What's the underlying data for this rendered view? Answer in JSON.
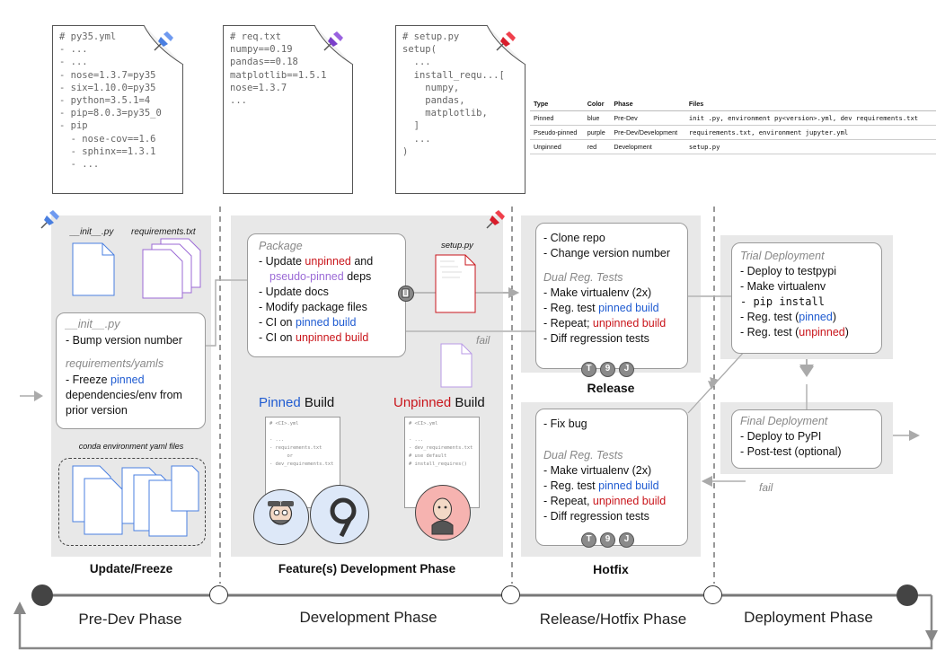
{
  "top_docs": {
    "py35": [
      "# py35.yml",
      "- ...",
      "- ...",
      "- nose=1.3.7=py35",
      "- six=1.10.0=py35",
      "- python=3.5.1=4",
      "- pip=8.0.3=py35_0",
      "- pip",
      "  - nose-cov==1.6",
      "  - sphinx==1.3.1",
      "  - ..."
    ],
    "req": [
      "# req.txt",
      "numpy==0.19",
      "pandas==0.18",
      "matplotlib==1.5.1",
      "nose=1.3.7",
      "..."
    ],
    "setup": [
      "# setup.py",
      "setup(",
      "  ...",
      "  install_requ...[",
      "    numpy,",
      "    pandas,",
      "    matplotlib,",
      "  ]",
      "  ...",
      ")"
    ]
  },
  "legend": {
    "headers": [
      "Type",
      "Color",
      "Phase",
      "Files"
    ],
    "rows": [
      [
        "Pinned",
        "blue",
        "Pre-Dev",
        "init  .py, environment  py<version>.yml, dev  requirements.txt"
      ],
      [
        "Pseudo-pinned",
        "purple",
        "Pre-Dev/Development",
        "requirements.txt, environment  jupyter.yml"
      ],
      [
        "Unpinned",
        "red",
        "Development",
        "setup.py"
      ]
    ]
  },
  "freeze": {
    "file1": "__init__.py",
    "file2": "requirements.txt",
    "card_title1": "__init__.py",
    "card_line1": "- Bump version number",
    "card_title2": "requirements/yamls",
    "card_line2a": "- Freeze ",
    "card_line2b": "pinned",
    "card_line3": "dependencies/env from",
    "card_line4": "prior version",
    "conda_label": "conda environment yaml files",
    "title": "Update/Freeze"
  },
  "dev": {
    "heading": "Package",
    "l1a": "- Update ",
    "l1b": "unpinned",
    "l1c": " and",
    "l2a": "pseudo-pinned",
    "l2b": " deps",
    "l3": "- Update docs",
    "l4": "- Modify package files",
    "l5a": "- CI on ",
    "l5b": "pinned build",
    "l6a": "- CI on ",
    "l6b": "unpinned build",
    "setup_label": "setup.py",
    "pinned_build_a": "Pinned",
    "pinned_build_b": " Build",
    "unpinned_build_a": "Unpinned",
    "unpinned_build_b": " Build",
    "ci_doc1": [
      "# <CI>.yml",
      "",
      "- ...",
      "- requirements.txt",
      "      or",
      "- dev_requirements.txt"
    ],
    "ci_doc2": [
      "# <CI>.yml",
      "",
      "- ...",
      "- dev_requirements.txt",
      "# use default",
      "# install_requires()"
    ],
    "title": "Feature(s) Development Phase"
  },
  "release": {
    "l1": "- Clone repo",
    "l2": "- Change version number",
    "h2": "Dual Reg. Tests",
    "l3": "- Make virtualenv (2x)",
    "l4a": "- Reg. test ",
    "l4b": "pinned build",
    "l5a": "- Repeat; ",
    "l5b": "unpinned build",
    "l6": "- Diff regression tests",
    "title": "Release",
    "fail": "fail"
  },
  "hotfix": {
    "l1": "- Fix bug",
    "h2": "Dual Reg. Tests",
    "l3": "- Make virtualenv (2x)",
    "l4a": "- Reg. test ",
    "l4b": "pinned build",
    "l5a": "- Repeat, ",
    "l5b": "unpinned build",
    "l6": "- Diff regression tests",
    "title": "Hotfix",
    "fail": "fail"
  },
  "trial": {
    "h": "Trial Deployment",
    "l1": "- Deploy to testpypi",
    "l2": "- Make virtualenv",
    "l3": "- pip install",
    "l4a": "- Reg. test (",
    "l4b": "pinned",
    "l4c": ")",
    "l5a": "- Reg. test (",
    "l5b": "unpinned",
    "l5c": ")"
  },
  "final": {
    "h": "Final Deployment",
    "l1": "- Deploy to PyPI",
    "l2": "- Post-test (optional)"
  },
  "phases": [
    "Pre-Dev Phase",
    "Development Phase",
    "Release/Hotfix Phase",
    "Deployment Phase"
  ],
  "colors": {
    "pinned": "#1f5bd1",
    "unpinned": "#c9151b",
    "pseudo": "#9b6ad6",
    "panel": "#e8e8e8"
  }
}
